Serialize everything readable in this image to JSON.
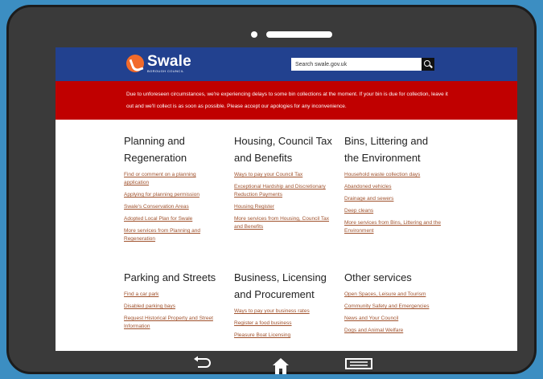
{
  "site": {
    "logo_name": "Swale",
    "logo_sub": "BOROUGH COUNCIL",
    "search_placeholder": "Search swale.gov.uk"
  },
  "alert": "Due to unforeseen circumstances, we're experiencing delays to some bin collections at the moment. If your bin is due for collection, leave it out and we'll collect is as soon as possible. Please accept our apologies for any inconvenience.",
  "sections": [
    {
      "title": "Planning and Regeneration",
      "links": [
        "Find or comment on a planning application",
        "Applying for planning permission",
        "Swale's Conservation Areas",
        "Adopted Local Plan for Swale",
        "More services from Planning and Regeneration"
      ]
    },
    {
      "title": "Housing, Council Tax and Benefits",
      "links": [
        "Ways to pay your Council Tax",
        "Exceptional Hardship and Discretionary Reduction Payments",
        "Housing Register",
        "More services from Housing, Council Tax and Benefits"
      ]
    },
    {
      "title": "Bins, Littering and the Environment",
      "links": [
        "Household waste collection days",
        "Abandoned vehicles",
        "Drainage and sewers",
        "Deep cleans",
        "More services from Bins, Littering and the Environment"
      ]
    },
    {
      "title": "Parking and Streets",
      "links": [
        "Find a car park",
        "Disabled parking bays",
        "Request Historical Property and Street Information"
      ]
    },
    {
      "title": "Business, Licensing and Procurement",
      "links": [
        "Ways to pay your business rates",
        "Register a food business",
        "Pleasure Boat Licensing"
      ]
    },
    {
      "title": "Other services",
      "links": [
        "Open Spaces, Leisure and Tourism",
        "Community Safety and Emergencies",
        "News and Your Council",
        "Dogs and Animal Welfare"
      ]
    }
  ],
  "nav": {
    "back_icon": "back-arrow-icon",
    "home_icon": "home-icon",
    "recent_icon": "recent-apps-icon"
  },
  "colors": {
    "header": "#22418f",
    "alert": "#c00000",
    "link": "#a0522d",
    "logo_accent": "#f26a2a"
  }
}
